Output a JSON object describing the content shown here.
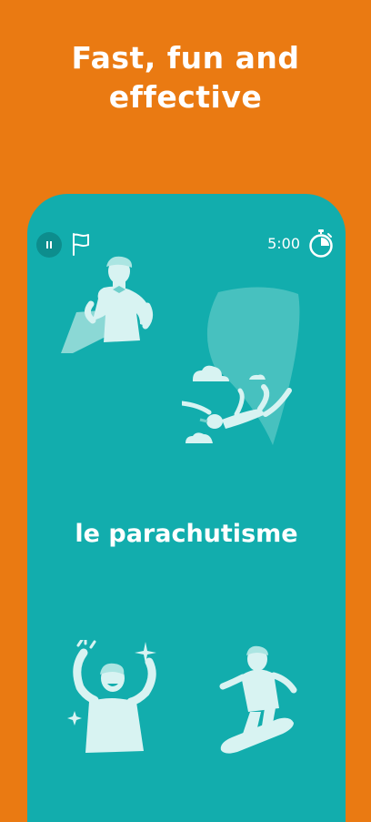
{
  "headline": {
    "line1": "Fast, fun and",
    "line2": "effective"
  },
  "phone": {
    "timer": "5:00",
    "word": "le parachutisme",
    "icons": {
      "pause": "pause-icon",
      "flag": "flag-icon",
      "stopwatch": "stopwatch-icon"
    },
    "illustrations": [
      "superhero-man",
      "skydiver",
      "cheering-man",
      "snowboarder"
    ]
  },
  "colors": {
    "background": "#EA7A12",
    "card": "#12ADAD",
    "illustration": "#D8F3F2"
  }
}
